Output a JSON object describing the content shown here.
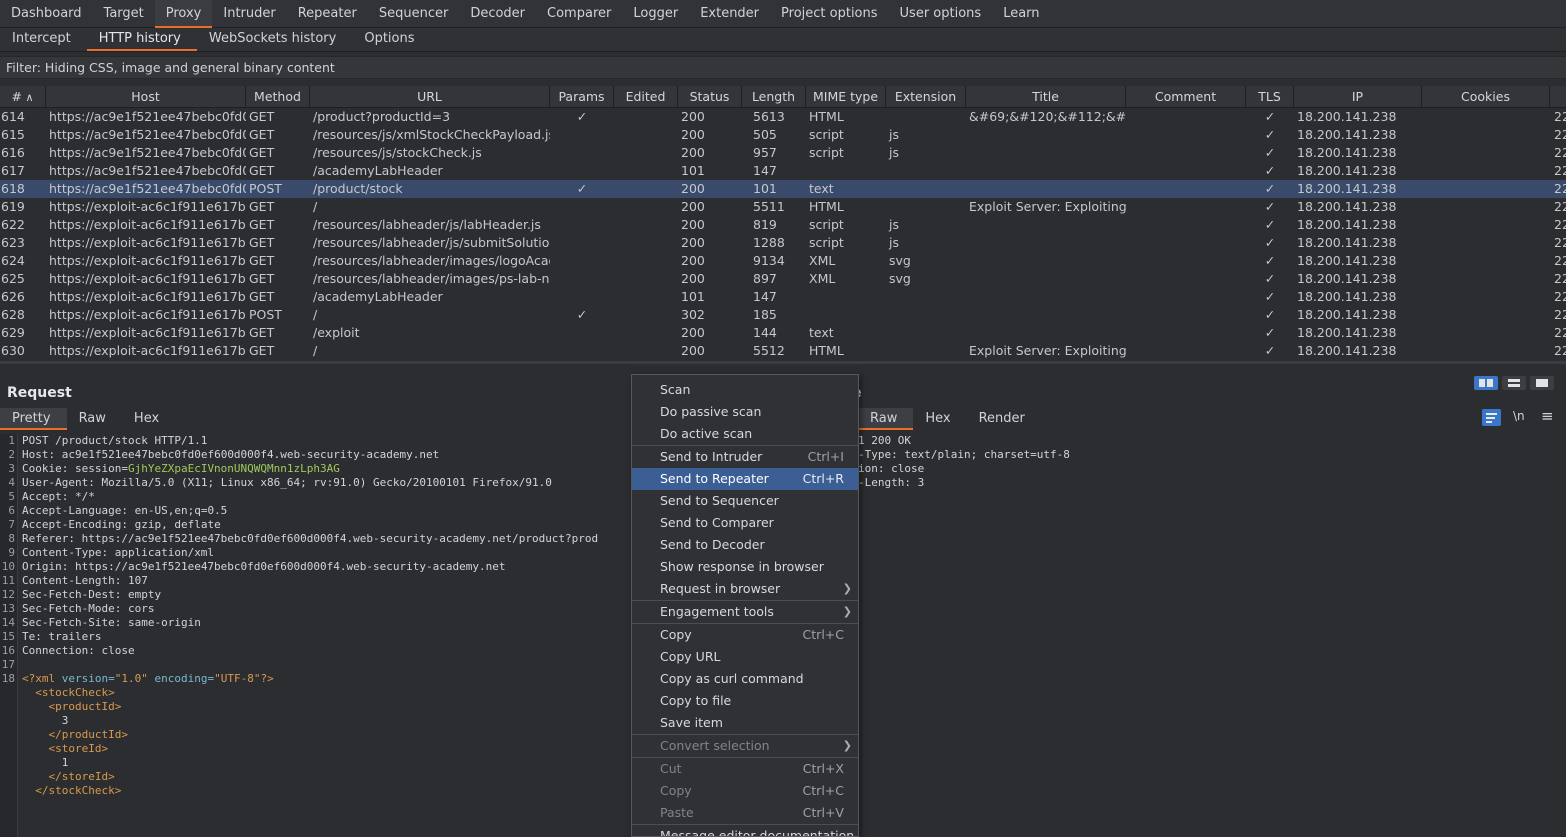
{
  "top_tabs": [
    "Dashboard",
    "Target",
    "Proxy",
    "Intruder",
    "Repeater",
    "Sequencer",
    "Decoder",
    "Comparer",
    "Logger",
    "Extender",
    "Project options",
    "User options",
    "Learn"
  ],
  "top_active": "Proxy",
  "sub_tabs": [
    "Intercept",
    "HTTP history",
    "WebSockets history",
    "Options"
  ],
  "sub_active": "HTTP history",
  "filter_text": "Filter: Hiding CSS, image and general binary content",
  "columns": [
    "#",
    "Host",
    "Method",
    "URL",
    "Params",
    "Edited",
    "Status",
    "Length",
    "MIME type",
    "Extension",
    "Title",
    "Comment",
    "TLS",
    "IP",
    "Cookies"
  ],
  "sort_glyph": "∧",
  "rows": [
    {
      "num": "614",
      "host": "https://ac9e1f521ee47bebc0fd0...",
      "method": "GET",
      "url": "/product?productId=3",
      "params": "✓",
      "status": "200",
      "length": "5613",
      "mime": "HTML",
      "ext": "",
      "title": "&#69;&#120;&#112;&#1...",
      "tls": "✓",
      "ip": "18.200.141.238",
      "cookies": "22"
    },
    {
      "num": "615",
      "host": "https://ac9e1f521ee47bebc0fd0...",
      "method": "GET",
      "url": "/resources/js/xmlStockCheckPayload.js",
      "params": "",
      "status": "200",
      "length": "505",
      "mime": "script",
      "ext": "js",
      "title": "",
      "tls": "✓",
      "ip": "18.200.141.238",
      "cookies": "22"
    },
    {
      "num": "616",
      "host": "https://ac9e1f521ee47bebc0fd0...",
      "method": "GET",
      "url": "/resources/js/stockCheck.js",
      "params": "",
      "status": "200",
      "length": "957",
      "mime": "script",
      "ext": "js",
      "title": "",
      "tls": "✓",
      "ip": "18.200.141.238",
      "cookies": "22"
    },
    {
      "num": "617",
      "host": "https://ac9e1f521ee47bebc0fd0...",
      "method": "GET",
      "url": "/academyLabHeader",
      "params": "",
      "status": "101",
      "length": "147",
      "mime": "",
      "ext": "",
      "title": "",
      "tls": "✓",
      "ip": "18.200.141.238",
      "cookies": "22"
    },
    {
      "num": "618",
      "host": "https://ac9e1f521ee47bebc0fd0...",
      "method": "POST",
      "url": "/product/stock",
      "params": "✓",
      "status": "200",
      "length": "101",
      "mime": "text",
      "ext": "",
      "title": "",
      "tls": "✓",
      "ip": "18.200.141.238",
      "cookies": "22",
      "selected": true
    },
    {
      "num": "619",
      "host": "https://exploit-ac6c1f911e617b...",
      "method": "GET",
      "url": "/",
      "params": "",
      "status": "200",
      "length": "5511",
      "mime": "HTML",
      "ext": "",
      "title": "Exploit Server: Exploiting...",
      "tls": "✓",
      "ip": "18.200.141.238",
      "cookies": "22"
    },
    {
      "num": "622",
      "host": "https://exploit-ac6c1f911e617b...",
      "method": "GET",
      "url": "/resources/labheader/js/labHeader.js",
      "params": "",
      "status": "200",
      "length": "819",
      "mime": "script",
      "ext": "js",
      "title": "",
      "tls": "✓",
      "ip": "18.200.141.238",
      "cookies": "22"
    },
    {
      "num": "623",
      "host": "https://exploit-ac6c1f911e617b...",
      "method": "GET",
      "url": "/resources/labheader/js/submitSolutio...",
      "params": "",
      "status": "200",
      "length": "1288",
      "mime": "script",
      "ext": "js",
      "title": "",
      "tls": "✓",
      "ip": "18.200.141.238",
      "cookies": "22"
    },
    {
      "num": "624",
      "host": "https://exploit-ac6c1f911e617b...",
      "method": "GET",
      "url": "/resources/labheader/images/logoAcad...",
      "params": "",
      "status": "200",
      "length": "9134",
      "mime": "XML",
      "ext": "svg",
      "title": "",
      "tls": "✓",
      "ip": "18.200.141.238",
      "cookies": "22"
    },
    {
      "num": "625",
      "host": "https://exploit-ac6c1f911e617b...",
      "method": "GET",
      "url": "/resources/labheader/images/ps-lab-n...",
      "params": "",
      "status": "200",
      "length": "897",
      "mime": "XML",
      "ext": "svg",
      "title": "",
      "tls": "✓",
      "ip": "18.200.141.238",
      "cookies": "22"
    },
    {
      "num": "626",
      "host": "https://exploit-ac6c1f911e617b...",
      "method": "GET",
      "url": "/academyLabHeader",
      "params": "",
      "status": "101",
      "length": "147",
      "mime": "",
      "ext": "",
      "title": "",
      "tls": "✓",
      "ip": "18.200.141.238",
      "cookies": "22"
    },
    {
      "num": "628",
      "host": "https://exploit-ac6c1f911e617b...",
      "method": "POST",
      "url": "/",
      "params": "✓",
      "status": "302",
      "length": "185",
      "mime": "",
      "ext": "",
      "title": "",
      "tls": "✓",
      "ip": "18.200.141.238",
      "cookies": "22"
    },
    {
      "num": "629",
      "host": "https://exploit-ac6c1f911e617b...",
      "method": "GET",
      "url": "/exploit",
      "params": "",
      "status": "200",
      "length": "144",
      "mime": "text",
      "ext": "",
      "title": "",
      "tls": "✓",
      "ip": "18.200.141.238",
      "cookies": "22"
    },
    {
      "num": "630",
      "host": "https://exploit-ac6c1f911e617b...",
      "method": "GET",
      "url": "/",
      "params": "",
      "status": "200",
      "length": "5512",
      "mime": "HTML",
      "ext": "",
      "title": "Exploit Server: Exploiting...",
      "tls": "✓",
      "ip": "18.200.141.238",
      "cookies": "22"
    }
  ],
  "request": {
    "title": "Request",
    "tabs": [
      "Pretty",
      "Raw",
      "Hex"
    ],
    "active_tab": "Pretty",
    "lines": [
      {
        "n": "1",
        "parts": [
          [
            "hdr",
            "POST /product/stock HTTP/1.1"
          ]
        ]
      },
      {
        "n": "2",
        "parts": [
          [
            "hdr",
            "Host: "
          ],
          [
            "val",
            "ac9e1f521ee47bebc0fd0ef600d000f4.web-security-academy.net"
          ]
        ]
      },
      {
        "n": "3",
        "parts": [
          [
            "hdr",
            "Cookie: "
          ],
          [
            "val",
            "session="
          ],
          [
            "green",
            "GjhYeZXpaEcIVnonUNQWQMnn1zLph3AG"
          ]
        ]
      },
      {
        "n": "4",
        "parts": [
          [
            "hdr",
            "User-Agent: "
          ],
          [
            "val",
            "Mozilla/5.0 (X11; Linux x86_64; rv:91.0) Gecko/20100101 Firefox/91.0"
          ]
        ]
      },
      {
        "n": "5",
        "parts": [
          [
            "hdr",
            "Accept: "
          ],
          [
            "val",
            "*/*"
          ]
        ]
      },
      {
        "n": "6",
        "parts": [
          [
            "hdr",
            "Accept-Language: "
          ],
          [
            "val",
            "en-US,en;q=0.5"
          ]
        ]
      },
      {
        "n": "7",
        "parts": [
          [
            "hdr",
            "Accept-Encoding: "
          ],
          [
            "val",
            "gzip, deflate"
          ]
        ]
      },
      {
        "n": "8",
        "parts": [
          [
            "hdr",
            "Referer: "
          ],
          [
            "val",
            "https://ac9e1f521ee47bebc0fd0ef600d000f4.web-security-academy.net/product?prod"
          ]
        ]
      },
      {
        "n": "9",
        "parts": [
          [
            "hdr",
            "Content-Type: "
          ],
          [
            "val",
            "application/xml"
          ]
        ]
      },
      {
        "n": "10",
        "parts": [
          [
            "hdr",
            "Origin: "
          ],
          [
            "val",
            "https://ac9e1f521ee47bebc0fd0ef600d000f4.web-security-academy.net"
          ]
        ]
      },
      {
        "n": "11",
        "parts": [
          [
            "hdr",
            "Content-Length: "
          ],
          [
            "val",
            "107"
          ]
        ]
      },
      {
        "n": "12",
        "parts": [
          [
            "hdr",
            "Sec-Fetch-Dest: "
          ],
          [
            "val",
            "empty"
          ]
        ]
      },
      {
        "n": "13",
        "parts": [
          [
            "hdr",
            "Sec-Fetch-Mode: "
          ],
          [
            "val",
            "cors"
          ]
        ]
      },
      {
        "n": "14",
        "parts": [
          [
            "hdr",
            "Sec-Fetch-Site: "
          ],
          [
            "val",
            "same-origin"
          ]
        ]
      },
      {
        "n": "15",
        "parts": [
          [
            "hdr",
            "Te: "
          ],
          [
            "val",
            "trailers"
          ]
        ]
      },
      {
        "n": "16",
        "parts": [
          [
            "hdr",
            "Connection: "
          ],
          [
            "val",
            "close"
          ]
        ]
      },
      {
        "n": "17",
        "parts": []
      },
      {
        "n": "18",
        "parts": [
          [
            "orange",
            "<?xml "
          ],
          [
            "cyan",
            "version="
          ],
          [
            "orange",
            "\"1.0\" "
          ],
          [
            "cyan",
            "encoding="
          ],
          [
            "orange",
            "\"UTF-8\""
          ],
          [
            "orange",
            "?>"
          ]
        ]
      },
      {
        "n": "",
        "parts": [
          [
            "val",
            "  "
          ],
          [
            "orange",
            "<stockCheck>"
          ]
        ]
      },
      {
        "n": "",
        "parts": [
          [
            "val",
            "    "
          ],
          [
            "orange",
            "<productId>"
          ]
        ]
      },
      {
        "n": "",
        "parts": [
          [
            "val",
            "      3"
          ]
        ]
      },
      {
        "n": "",
        "parts": [
          [
            "val",
            "    "
          ],
          [
            "orange",
            "</productId>"
          ]
        ]
      },
      {
        "n": "",
        "parts": [
          [
            "val",
            "    "
          ],
          [
            "orange",
            "<storeId>"
          ]
        ]
      },
      {
        "n": "",
        "parts": [
          [
            "val",
            "      1"
          ]
        ]
      },
      {
        "n": "",
        "parts": [
          [
            "val",
            "    "
          ],
          [
            "orange",
            "</storeId>"
          ]
        ]
      },
      {
        "n": "",
        "parts": [
          [
            "val",
            "  "
          ],
          [
            "orange",
            "</stockCheck>"
          ]
        ]
      }
    ]
  },
  "response": {
    "title_fragment": "e",
    "tabs": [
      "Raw",
      "Hex",
      "Render"
    ],
    "active_tab": "Raw",
    "lines": [
      "1 200 OK",
      "-Type: text/plain; charset=utf-8",
      "ion: close",
      "-Length: 3"
    ],
    "wrap_label": "\\n",
    "menu_glyph": "≡"
  },
  "context_menu": [
    {
      "label": "Scan"
    },
    {
      "label": "Do passive scan"
    },
    {
      "label": "Do active scan"
    },
    {
      "sep": true
    },
    {
      "label": "Send to Intruder",
      "shortcut": "Ctrl+I"
    },
    {
      "label": "Send to Repeater",
      "shortcut": "Ctrl+R",
      "highlight": true
    },
    {
      "label": "Send to Sequencer"
    },
    {
      "label": "Send to Comparer"
    },
    {
      "label": "Send to Decoder"
    },
    {
      "label": "Show response in browser"
    },
    {
      "label": "Request in browser",
      "submenu": true
    },
    {
      "sep": true
    },
    {
      "label": "Engagement tools",
      "submenu": true
    },
    {
      "sep": true
    },
    {
      "label": "Copy",
      "shortcut": "Ctrl+C"
    },
    {
      "label": "Copy URL"
    },
    {
      "label": "Copy as curl command"
    },
    {
      "label": "Copy to file"
    },
    {
      "label": "Save item"
    },
    {
      "sep": true
    },
    {
      "label": "Convert selection",
      "submenu": true,
      "disabled": true
    },
    {
      "sep": true
    },
    {
      "label": "Cut",
      "shortcut": "Ctrl+X",
      "disabled": true
    },
    {
      "label": "Copy",
      "shortcut": "Ctrl+C",
      "disabled": true
    },
    {
      "label": "Paste",
      "shortcut": "Ctrl+V",
      "disabled": true
    },
    {
      "sep": true
    },
    {
      "label": "Message editor documentation"
    }
  ],
  "colors": {
    "accent": "#e8702a",
    "selected_row": "#3a4a6b",
    "menu_highlight": "#3b5f95",
    "layout_active": "#3b77c9"
  }
}
